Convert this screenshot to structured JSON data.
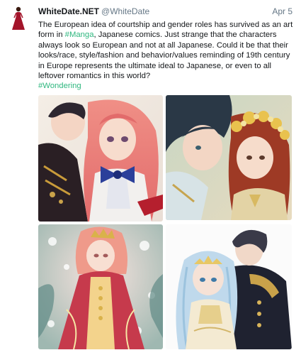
{
  "author": {
    "name": "WhiteDate.NET",
    "handle": "@WhiteDate"
  },
  "date": "Apr 5",
  "text": {
    "part1": "The European idea of courtship and gender roles has survived as an art form in ",
    "hashtag1": "#Manga",
    "part2": ", Japanese comics. Just strange that the characters always look so European and not at all Japanese. Could it be that their looks/race, style/fashion and behavior/values reminding of 19th century in Europe represents the ultimate ideal to Japanese, or even to all leftover romantics in this world?",
    "hashtag2": "#Wondering"
  },
  "media": {
    "count": 4,
    "accent": "#2fb77f"
  }
}
